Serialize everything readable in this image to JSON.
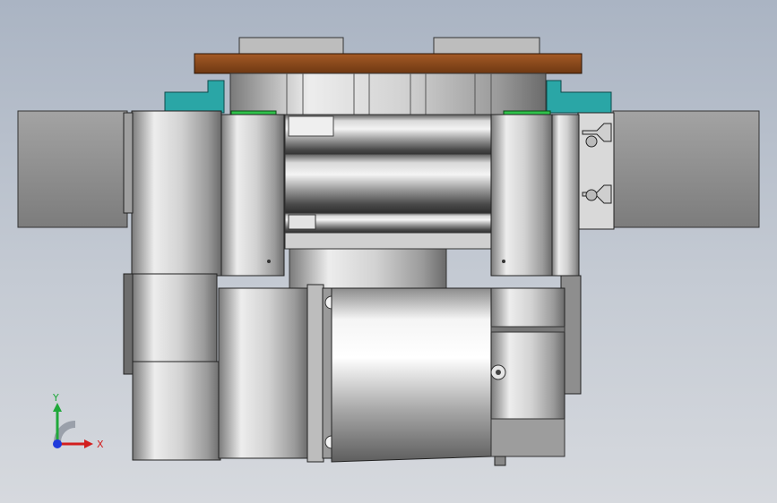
{
  "viewport": {
    "background_top": "#aab4c3",
    "background_bottom": "#d6d9de"
  },
  "triad": {
    "x_label": "X",
    "y_label": "Y",
    "x_color": "#d21e1e",
    "y_color": "#1fa83a",
    "z_color": "#1f3adb"
  },
  "model": {
    "plate_color": "#8b4a1d",
    "bracket_color": "#2aa6a6",
    "seal_color": "#2fc24a",
    "steel_color": "#c9c9c9",
    "block_color": "#8a8a8a"
  }
}
